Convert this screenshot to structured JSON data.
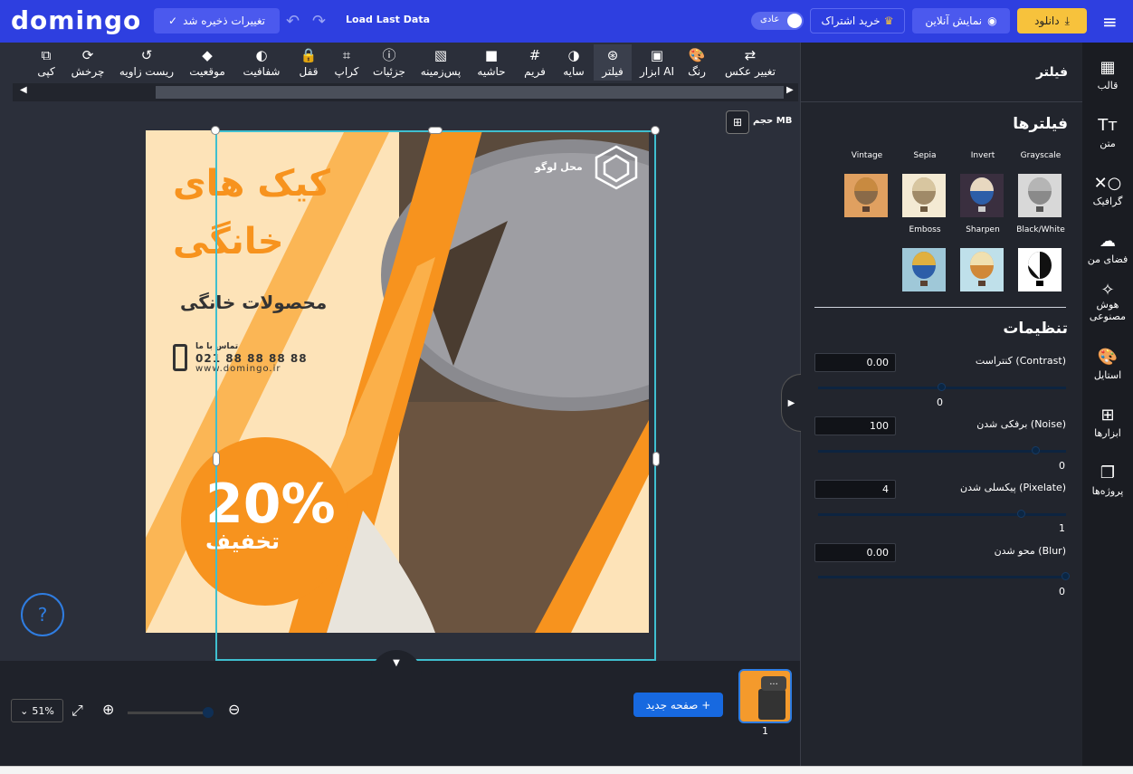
{
  "topbar": {
    "logo": "domingo",
    "saved_label": "تغییرات ذخیره شد",
    "load_last": "Load Last Data",
    "mode_label": "عادی",
    "subscribe_label": "خرید اشتراک",
    "preview_label": "نمایش آنلاین",
    "download_label": "دانلود"
  },
  "toolbar": {
    "items": [
      {
        "label": "کپی",
        "icon": "copy-icon",
        "glyph": "⧉"
      },
      {
        "label": "چرخش",
        "icon": "rotate-icon",
        "glyph": "⟳"
      },
      {
        "label": "ریست زاویه",
        "icon": "reset-angle-icon",
        "glyph": "↺"
      },
      {
        "label": "موقعیت",
        "icon": "layers-icon",
        "glyph": "◆"
      },
      {
        "label": "شفافیت",
        "icon": "opacity-icon",
        "glyph": "◐"
      },
      {
        "label": "قفل",
        "icon": "lock-icon",
        "glyph": "🔒"
      },
      {
        "label": "کراپ",
        "icon": "crop-icon",
        "glyph": "⌗"
      },
      {
        "label": "جزئیات",
        "icon": "info-icon",
        "glyph": "ⓘ"
      },
      {
        "label": "پس‌زمینه",
        "icon": "background-icon",
        "glyph": "▧"
      },
      {
        "label": "حاشیه",
        "icon": "border-icon",
        "glyph": "■"
      },
      {
        "label": "فریم",
        "icon": "frame-icon",
        "glyph": "#"
      },
      {
        "label": "سایه",
        "icon": "shadow-icon",
        "glyph": "◑"
      },
      {
        "label": "فیلتر",
        "icon": "filter-icon",
        "glyph": "⊛"
      },
      {
        "label": "ابزار AI",
        "icon": "ai-tools-icon",
        "glyph": "▣"
      },
      {
        "label": "رنگ",
        "icon": "palette-icon",
        "glyph": "🎨"
      },
      {
        "label": "تغییر عکس",
        "icon": "replace-image-icon",
        "glyph": "⇄"
      }
    ]
  },
  "canvas": {
    "size_label": "حجم MB",
    "design": {
      "title_line1": "کیک های",
      "title_line2": "خانگی",
      "subtitle": "محصولات خانگی",
      "contact": "تماس با ما",
      "phone": "021 88 88 88 88",
      "website": "www.domingo.ir",
      "discount": "20%",
      "discount_label": "تخفیف",
      "logo_text": "محل لوگو"
    }
  },
  "bottombar": {
    "zoom": "51%",
    "new_page": "صفحه جدید",
    "page_number": "1",
    "thumb_more": "..."
  },
  "panel": {
    "title": "فیلتر",
    "filters_heading": "فیلترها",
    "filters": [
      "Grayscale",
      "Invert",
      "Sepia",
      "Vintage",
      "Black/White",
      "Sharpen",
      "Emboss"
    ],
    "settings_heading": "تنظیمات",
    "settings": [
      {
        "label": "کنتراست (Contrast)",
        "value": "0.00",
        "slider_value": "0",
        "level": 0.5
      },
      {
        "label": "برفکی شدن (Noise)",
        "value": "100",
        "slider_value": "0",
        "level": 0.88
      },
      {
        "label": "پیکسلی شدن (Pixelate)",
        "value": "4",
        "slider_value": "1",
        "level": 0.82
      },
      {
        "label": "محو شدن (Blur)",
        "value": "0.00",
        "slider_value": "0",
        "level": 1.0
      }
    ]
  },
  "rightnav": [
    {
      "label": "قالب",
      "icon": "template-icon",
      "glyph": "▦"
    },
    {
      "label": "متن",
      "icon": "text-icon",
      "glyph": "Tт"
    },
    {
      "label": "گرافیک",
      "icon": "graphics-icon",
      "glyph": "✕○"
    },
    {
      "label": "فضای من",
      "icon": "upload-cloud-icon",
      "glyph": "☁"
    },
    {
      "label": "هوش مصنوعی",
      "icon": "ai-wand-icon",
      "glyph": "✧"
    },
    {
      "label": "استایل",
      "icon": "style-palette-icon",
      "glyph": "🎨"
    },
    {
      "label": "ابزارها",
      "icon": "tools-grid-icon",
      "glyph": "⊞"
    },
    {
      "label": "پروژه‌ها",
      "icon": "projects-icon",
      "glyph": "❐"
    }
  ],
  "colors": {
    "brand_blue": "#2e3fe0",
    "accent_orange": "#f7931e",
    "download_yellow": "#f7c23c",
    "selection": "#3fbfcf"
  }
}
